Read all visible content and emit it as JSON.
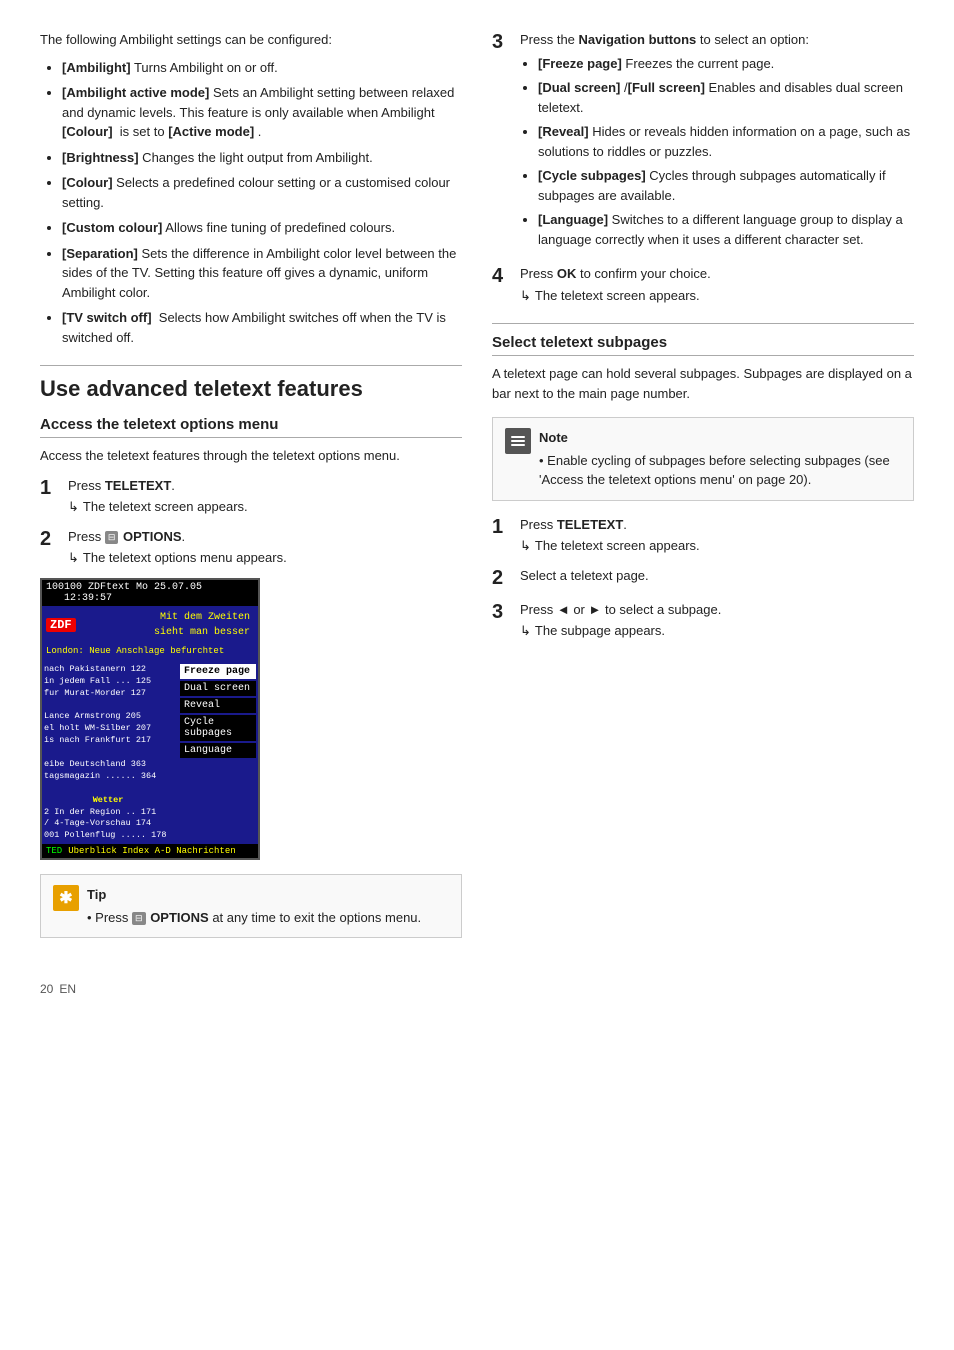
{
  "left_col": {
    "intro": "The following Ambilight settings can be configured:",
    "bullet_items": [
      {
        "label": "[Ambilight]",
        "text": " Turns Ambilight on or off."
      },
      {
        "label": "[Ambilight active mode]",
        "text": " Sets an Ambilight setting between relaxed and dynamic levels. This feature is only available when Ambilight "
      },
      {
        "label_colour": "[Colour]",
        "text_mid": "  is set to ",
        "label_active": "[Active mode]",
        "text_end": " .",
        "is_special": true
      },
      {
        "label": "[Brightness]",
        "text": " Changes the light output from Ambilight."
      },
      {
        "label": "[Colour]",
        "text": " Selects a predefined colour setting or a customised colour setting."
      },
      {
        "label": "[Custom colour]",
        "text": " Allows fine tuning of predefined colours."
      },
      {
        "label": "[Separation]",
        "text": " Sets the difference in Ambilight color level between the sides of the TV. Setting this feature off gives a dynamic, uniform Ambilight color."
      },
      {
        "label": "[TV switch off]",
        "text": "  Selects how Ambilight switches off when the TV is switched off."
      }
    ]
  },
  "use_advanced": {
    "section_title": "Use advanced teletext features",
    "access_menu": {
      "subtitle": "Access the teletext options menu",
      "intro": "Access the teletext features through the teletext options menu.",
      "steps": [
        {
          "number": "1",
          "text_before": "Press ",
          "bold": "TELETEXT",
          "text_after": ".",
          "result": "The teletext screen appears."
        },
        {
          "number": "2",
          "text_before": "Press ",
          "icon": true,
          "bold": "OPTIONS",
          "text_after": ".",
          "result": "The teletext options menu appears."
        }
      ]
    },
    "teletext_screen": {
      "header_left": "100",
      "header_right": "100 ZDFtext Mo 25.07.05 12:39:57",
      "logo": "ZDF",
      "headline1": "Mit dem Zweiten",
      "headline2": "sieht man besser",
      "news_ticker": "London: Neue Anschlage befurchtet",
      "menu_items": [
        {
          "label": "Freeze page",
          "selected": true
        },
        {
          "label": "Dual screen",
          "selected": false
        },
        {
          "label": "Reveal",
          "selected": false
        },
        {
          "label": "Cycle subpages",
          "selected": false
        },
        {
          "label": "Language",
          "selected": false
        }
      ],
      "news_lines": [
        "nach Pakistanern 122",
        "in jedem Fall ... 125",
        "fur Murat-Morder 127",
        "",
        "Lance Armstrong 205",
        "holt WM-Silber 207",
        "is nach Frankfurt 217",
        "",
        "eibe Deutschland 363",
        "tagsmagazin ...... 364",
        "",
        "Wetter",
        "In der Region .. 171",
        "4-Tage-Vorschau 174",
        "Pollenflug ...... 178"
      ],
      "footer_items": [
        "TED",
        "Uberblick Index A-D Nachrichten"
      ]
    },
    "tip": {
      "label": "Tip",
      "text": "Press ",
      "icon_text": "OPTIONS",
      "text_after": " at any time to exit the options menu."
    }
  },
  "right_col": {
    "step3": {
      "number": "3",
      "text_before": "Press the ",
      "bold": "Navigation buttons",
      "text_after": " to select an option:",
      "sub_bullets": [
        {
          "label": "[Freeze page]",
          "text": " Freezes the current page."
        },
        {
          "label": "[Dual screen]",
          "text": " /",
          "label2": "[Full screen]",
          "text2": " Enables and disables dual screen teletext."
        },
        {
          "label": "[Reveal]",
          "text": " Hides or reveals hidden information on a page, such as solutions to riddles or puzzles."
        },
        {
          "label": "[Cycle subpages]",
          "text": " Cycles through subpages automatically if subpages are available."
        },
        {
          "label": "[Language]",
          "text": " Switches to a different language group to display a language correctly when it uses a different character set."
        }
      ]
    },
    "step4": {
      "number": "4",
      "text_before": "Press ",
      "bold": "OK",
      "text_after": " to confirm your choice.",
      "result": "The teletext screen appears."
    }
  },
  "select_subpages": {
    "subtitle": "Select teletext subpages",
    "intro": "A teletext page can hold several subpages. Subpages are displayed on a bar next to the main page number.",
    "note": {
      "label": "Note",
      "text": "Enable cycling of subpages before selecting subpages (see 'Access the teletext options menu' on page 20)."
    },
    "steps": [
      {
        "number": "1",
        "text_before": "Press ",
        "bold": "TELETEXT",
        "text_after": ".",
        "result": "The teletext screen appears."
      },
      {
        "number": "2",
        "text_before": "Select a teletext page.",
        "bold": ""
      },
      {
        "number": "3",
        "text_before": "Press ◄ or ► to select a subpage.",
        "bold": "",
        "result": "The subpage appears."
      }
    ]
  },
  "page_number": "20",
  "page_lang": "EN",
  "arrow_symbol": "↳",
  "options_icon_label": "⊟"
}
